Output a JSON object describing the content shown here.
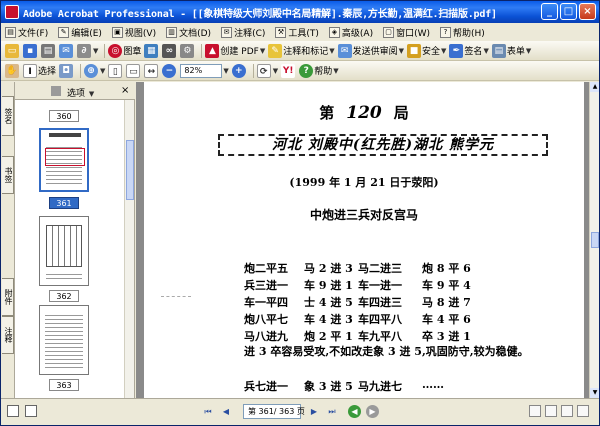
{
  "window": {
    "title": "Adobe Acrobat Professional - [[象棋特级大师刘殿中名局精解].秦辰,方长勤,温满红.扫描版.pdf]",
    "minimize": "_",
    "maximize": "□",
    "close": "×"
  },
  "menu": [
    {
      "label": "文件(F)",
      "icon": "file-icon"
    },
    {
      "label": "编辑(E)",
      "icon": "edit-icon"
    },
    {
      "label": "视图(V)",
      "icon": "view-icon"
    },
    {
      "label": "文档(D)",
      "icon": "document-icon"
    },
    {
      "label": "注释(C)",
      "icon": "comment-icon"
    },
    {
      "label": "工具(T)",
      "icon": "tools-icon"
    },
    {
      "label": "高级(A)",
      "icon": "advanced-icon"
    },
    {
      "label": "窗口(W)",
      "icon": "window-icon"
    },
    {
      "label": "帮助(H)",
      "icon": "help-icon"
    }
  ],
  "toolbar1": {
    "picture": "图章",
    "create_pdf": "创建 PDF",
    "comment_markup": "注释和标记",
    "send_review": "发送供审阅",
    "security": "安全",
    "sign": "签名",
    "forms": "表单"
  },
  "toolbar2": {
    "select": "选择",
    "zoom": "82%",
    "help": "帮助"
  },
  "side_tabs": [
    "签名",
    "书签",
    "附件",
    "注释"
  ],
  "panel": {
    "options": "选项",
    "close": "×",
    "pages": [
      "360",
      "361",
      "362",
      "363"
    ],
    "selected_page": "361"
  },
  "document": {
    "heading_prefix": "第",
    "heading_num": "120",
    "heading_suffix": "局",
    "banner": "河北 刘殿中(红先胜)湖北 熊学元",
    "date": "(1999 年 1 月 21 日于荥阳)",
    "subtitle": "中炮进三兵对反宫马",
    "moves": [
      [
        "炮二平五",
        "马 2 进 3",
        "马二进三",
        "炮 8 平 6"
      ],
      [
        "兵三进一",
        "车 9 进 1",
        "车一进一",
        "车 9 平 4"
      ],
      [
        "车一平四",
        "士 4 进 5",
        "车四进三",
        "马 8 进 7"
      ],
      [
        "炮八平七",
        "车 4 进 3",
        "车四平八",
        "车 4 平 6"
      ],
      [
        "马八进九",
        "炮 2 平 1",
        "车九平八",
        "卒 3 进 1"
      ]
    ],
    "commentary": "进 3 卒容易受攻,不如改走象 3 进 5,巩固防守,较为稳健。",
    "after_moves": [
      "兵七进一",
      "象 3 进 5",
      "马九进七",
      "……"
    ]
  },
  "status": {
    "page_field": "第 361/ 363 页",
    "first": "⏮",
    "prev": "◀",
    "next": "▶",
    "last": "⏭",
    "back": "◀",
    "forward": "▶"
  }
}
